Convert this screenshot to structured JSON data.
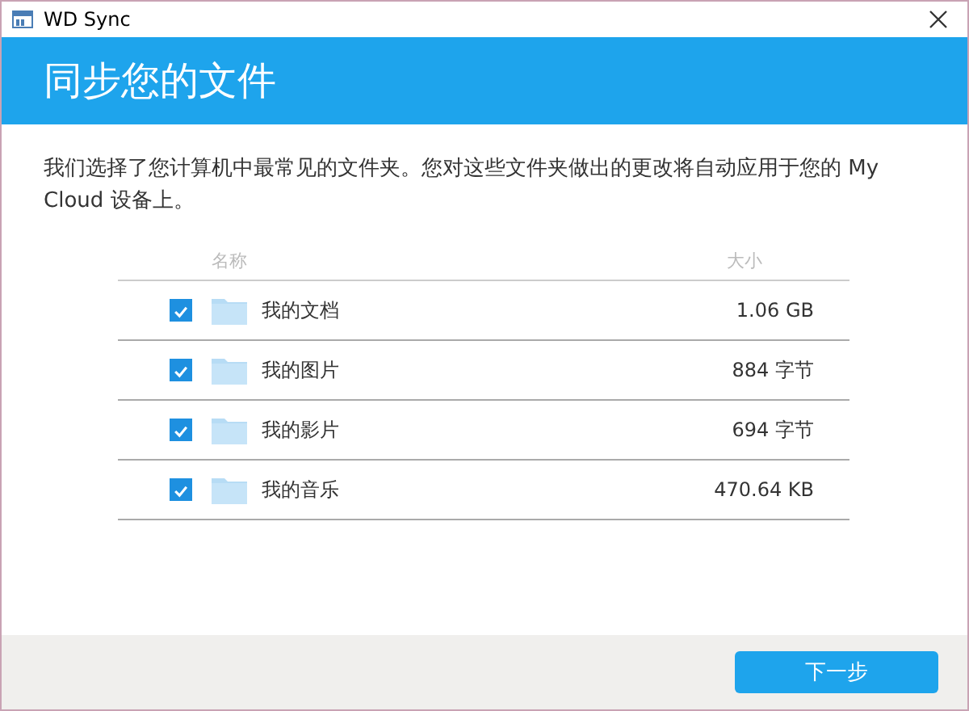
{
  "window": {
    "title": "WD Sync"
  },
  "header": {
    "title": "同步您的文件"
  },
  "description": "我们选择了您计算机中最常见的文件夹。您对这些文件夹做出的更改将自动应用于您的 My Cloud 设备上。",
  "table": {
    "columns": [
      "名称",
      "大小"
    ],
    "rows": [
      {
        "name": "我的文档",
        "size": "1.06 GB",
        "checked": true
      },
      {
        "name": "我的图片",
        "size": "884 字节",
        "checked": true
      },
      {
        "name": "我的影片",
        "size": "694 字节",
        "checked": true
      },
      {
        "name": "我的音乐",
        "size": "470.64 KB",
        "checked": true
      }
    ]
  },
  "buttons": [
    "下一步"
  ]
}
